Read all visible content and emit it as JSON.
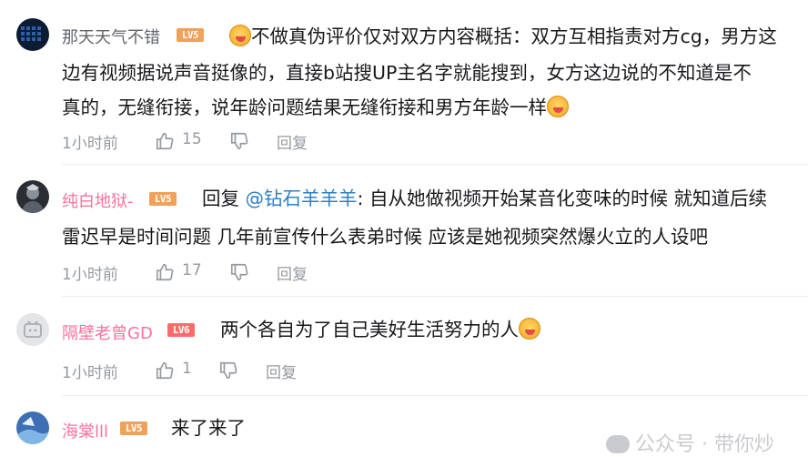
{
  "comments": [
    {
      "username": "那天天气不错",
      "level": "LV5",
      "level_color": "#f0a15a",
      "lines": [
        "不做真伪评价仅对双方内容概括：双方互相指责对方cg，男方这",
        "边有视频据说声音挺像的，直接b站搜UP主名字就能搜到，女方这边说的不知道是不",
        "真的，无缝衔接，说年龄问题结果无缝衔接和男方年龄一样"
      ],
      "time": "1小时前",
      "likes": "15",
      "reply_label": "回复"
    },
    {
      "username": "纯白地狱-",
      "level": "LV5",
      "level_color": "#f0a15a",
      "reply_prefix": "回复",
      "mention": "@钻石羊羊羊",
      "lines": [
        ": 自从她做视频开始某音化变味的时候 就知道后续",
        "雷迟早是时间问题 几年前宣传什么表弟时候 应该是她视频突然爆火立的人设吧"
      ],
      "time": "1小时前",
      "likes": "17",
      "reply_label": "回复"
    },
    {
      "username": "隔壁老曾GD",
      "level": "LV6",
      "level_color": "#ff6b6b",
      "lines": [
        "两个各自为了自己美好生活努力的人"
      ],
      "time": "1小时前",
      "likes": "1",
      "reply_label": "回复"
    },
    {
      "username": "海棠lll",
      "level": "LV5",
      "level_color": "#f0a15a",
      "lines": [
        "来了来了"
      ]
    }
  ],
  "watermark": "公众号 · 带你炒"
}
